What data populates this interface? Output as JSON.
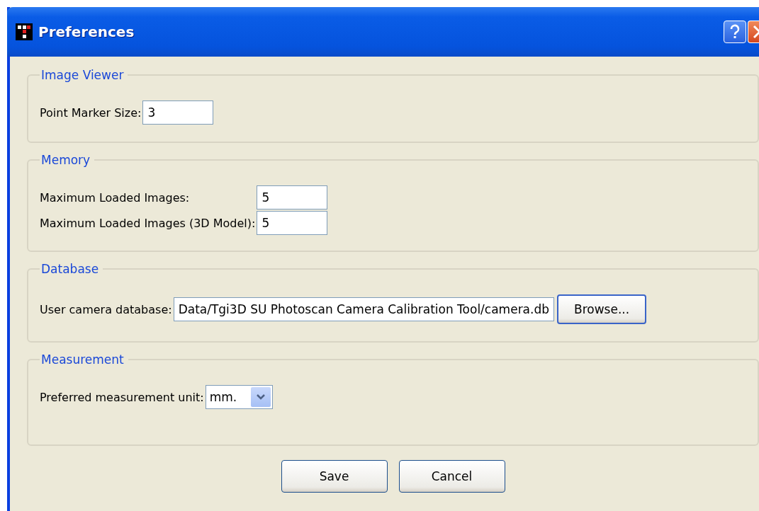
{
  "window": {
    "title": "Preferences"
  },
  "groups": [
    {
      "title": "Image Viewer",
      "fields": [
        {
          "kind": "text",
          "label": "Point Marker Size:",
          "value": "3"
        }
      ]
    },
    {
      "title": "Memory",
      "fields": [
        {
          "kind": "text",
          "label": "Maximum Loaded Images:",
          "value": "5"
        },
        {
          "kind": "text",
          "label": "Maximum Loaded Images (3D Model):",
          "value": "5"
        }
      ]
    },
    {
      "title": "Database",
      "fields": [
        {
          "kind": "file",
          "label": "User camera database:",
          "value": "Data/Tgi3D SU Photoscan Camera Calibration Tool/camera.db",
          "button": "Browse..."
        }
      ]
    },
    {
      "title": "Measurement",
      "fields": [
        {
          "kind": "select",
          "label": "Preferred measurement unit:",
          "value": "mm."
        }
      ]
    }
  ],
  "buttons": [
    "Save",
    "Cancel"
  ]
}
